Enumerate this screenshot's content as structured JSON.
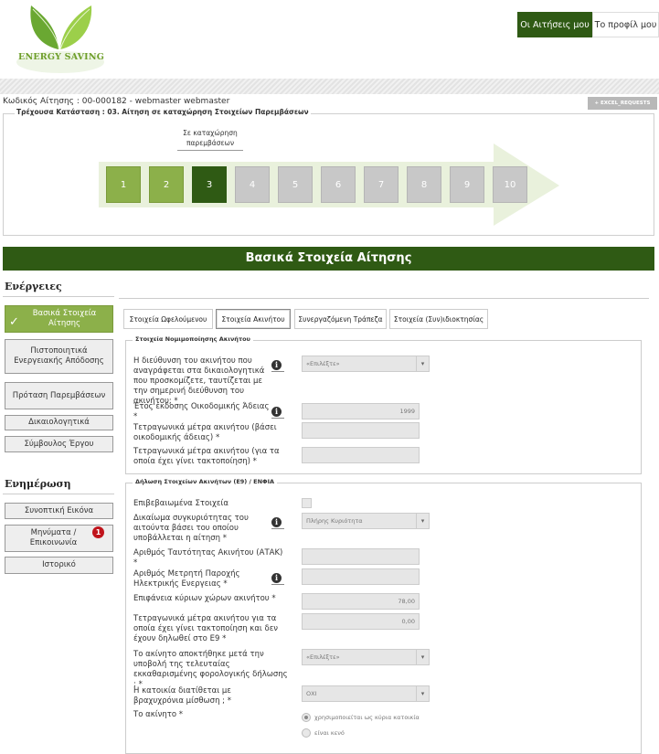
{
  "header": {
    "logo_text": "ENERGY SAVING",
    "nav": [
      {
        "label": "Οι Αιτήσεις μου",
        "active": true
      },
      {
        "label": "Το προφίλ μου",
        "active": false
      }
    ]
  },
  "request": {
    "code_line": "Κωδικός Αίτησης : 00-000182 - webmaster webmaster",
    "export_label": "EXCEL_REQUESTS",
    "status_legend": "Τρέχουσα Κατάσταση : 03. Αίτηση σε καταχώρηση Στοιχείων Παρεμβάσεων",
    "current_step_tip": "Σε καταχώρηση παρεμβάσεων",
    "steps": [
      "1",
      "2",
      "3",
      "4",
      "5",
      "6",
      "7",
      "8",
      "9",
      "10"
    ],
    "current_step": 3
  },
  "main_title": "Βασικά Στοιχεία Αίτησης",
  "sidebar": {
    "actions_title": "Ενέργειες",
    "actions": [
      {
        "label": "Βασικά Στοιχεία Αίτησης",
        "active": true
      },
      {
        "label": "Πιστοποιητικά Ενεργειακής Απόδοσης",
        "active": false
      },
      {
        "label": "Πρόταση Παρεμβάσεων",
        "active": false
      },
      {
        "label": "Δικαιολογητικά",
        "active": false
      },
      {
        "label": "Σύμβουλος Έργου",
        "active": false
      }
    ],
    "info_title": "Ενημέρωση",
    "info": [
      {
        "label": "Συνοπτική Εικόνα"
      },
      {
        "label": "Μηνύματα / Επικοινωνία",
        "badge": "1"
      },
      {
        "label": "Ιστορικό"
      }
    ]
  },
  "tabs": [
    {
      "label": "Στοιχεία Ωφελούμενου",
      "active": false
    },
    {
      "label": "Στοιχεία Ακινήτου",
      "active": true
    },
    {
      "label": "Συνεργαζόμενη Τράπεζα",
      "active": false
    },
    {
      "label": "Στοιχεία (Συν)ιδιοκτησίας",
      "active": false
    }
  ],
  "section1": {
    "legend": "Στοιχεία Νομιμοποίησης Ακινήτου",
    "address_match": {
      "label": "Η διεύθυνση του ακινήτου που αναγράφεται στα δικαιολογητικά που προσκομίζετε, ταυτίζεται με την σημερινή διεύθυνση του ακινήτου; *",
      "value": "«Επιλέξτε»"
    },
    "permit_year": {
      "label": "Έτος έκδοσης Οικοδομικής Άδειας *",
      "value": "1999"
    },
    "sqm_permit": {
      "label": "Τετραγωνικά μέτρα ακινήτου (βάσει οικοδομικής άδειας) *",
      "value": ""
    },
    "sqm_legalized": {
      "label": "Τετραγωνικά μέτρα ακινήτου (για τα οποία έχει γίνει τακτοποίηση) *",
      "value": ""
    }
  },
  "section2": {
    "legend": "Δήλωση Στοιχείων Ακινήτων (Ε9) / ΕΝΦΙΑ",
    "confirmed": {
      "label": "Επιβεβαιωμένα Στοιχεία"
    },
    "ownership_right": {
      "label": "Δικαίωμα συγκυριότητας του αιτούντα βάσει του οποίου υποβάλλεται η αίτηση *",
      "value": "Πλήρης Κυριότητα"
    },
    "atak": {
      "label": "Αριθμός Ταυτότητας Ακινήτου (ΑΤΑΚ) *",
      "value": ""
    },
    "meter": {
      "label": "Αριθμός Μετρητή Παροχής Ηλεκτρικής Ενεργειας *",
      "value": ""
    },
    "main_area": {
      "label": "Επιφάνεια κύριων χώρων ακινήτου *",
      "value": "78,00"
    },
    "legalized_not_e9": {
      "label": "Τετραγωνικά μέτρα ακινήτου για τα οποία έχει γίνει τακτοποίηση και δεν έχουν δηλωθεί στο Ε9 *",
      "value": "0,00"
    },
    "acquired_after": {
      "label": "Το ακίνητο αποκτήθηκε μετά την υποβολή της τελευταίας εκκαθαρισμένης φορολογικής δήλωσης ; *",
      "value": "«Επιλέξτε»"
    },
    "short_term": {
      "label": "Η κατοικία διατίθεται με βραχυχρόνια μίσθωση ; *",
      "value": "ΟΧΙ"
    },
    "property_use": {
      "label": "Το ακίνητο *",
      "options": [
        "χρησιμοποιείται ως κύρια κατοικία",
        "είναι κενό"
      ],
      "selected": 0
    }
  }
}
